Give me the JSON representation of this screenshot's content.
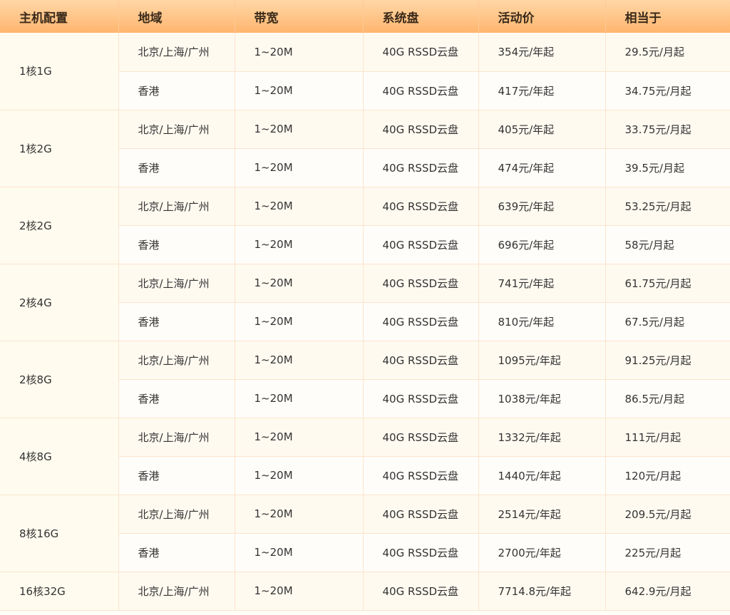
{
  "headers": [
    "主机配置",
    "地域",
    "带宽",
    "系统盘",
    "活动价",
    "相当于"
  ],
  "groups": [
    {
      "config": "1核1G",
      "rows": [
        {
          "region": "北京/上海/广州",
          "bandwidth": "1~20M",
          "disk": "40G RSSD云盘",
          "price": "354元/年起",
          "monthly": "29.5元/月起"
        },
        {
          "region": "香港",
          "bandwidth": "1~20M",
          "disk": "40G RSSD云盘",
          "price": "417元/年起",
          "monthly": "34.75元/月起"
        }
      ]
    },
    {
      "config": "1核2G",
      "rows": [
        {
          "region": "北京/上海/广州",
          "bandwidth": "1~20M",
          "disk": "40G RSSD云盘",
          "price": "405元/年起",
          "monthly": "33.75元/月起"
        },
        {
          "region": "香港",
          "bandwidth": "1~20M",
          "disk": "40G RSSD云盘",
          "price": "474元/年起",
          "monthly": "39.5元/月起"
        }
      ]
    },
    {
      "config": "2核2G",
      "rows": [
        {
          "region": "北京/上海/广州",
          "bandwidth": "1~20M",
          "disk": "40G RSSD云盘",
          "price": "639元/年起",
          "monthly": "53.25元/月起"
        },
        {
          "region": "香港",
          "bandwidth": "1~20M",
          "disk": "40G RSSD云盘",
          "price": "696元/年起",
          "monthly": "58元/月起"
        }
      ]
    },
    {
      "config": "2核4G",
      "rows": [
        {
          "region": "北京/上海/广州",
          "bandwidth": "1~20M",
          "disk": "40G RSSD云盘",
          "price": "741元/年起",
          "monthly": "61.75元/月起"
        },
        {
          "region": "香港",
          "bandwidth": "1~20M",
          "disk": "40G RSSD云盘",
          "price": "810元/年起",
          "monthly": "67.5元/月起"
        }
      ]
    },
    {
      "config": "2核8G",
      "rows": [
        {
          "region": "北京/上海/广州",
          "bandwidth": "1~20M",
          "disk": "40G RSSD云盘",
          "price": "1095元/年起",
          "monthly": "91.25元/月起"
        },
        {
          "region": "香港",
          "bandwidth": "1~20M",
          "disk": "40G RSSD云盘",
          "price": "1038元/年起",
          "monthly": "86.5元/月起"
        }
      ]
    },
    {
      "config": "4核8G",
      "rows": [
        {
          "region": "北京/上海/广州",
          "bandwidth": "1~20M",
          "disk": "40G RSSD云盘",
          "price": "1332元/年起",
          "monthly": "111元/月起"
        },
        {
          "region": "香港",
          "bandwidth": "1~20M",
          "disk": "40G RSSD云盘",
          "price": "1440元/年起",
          "monthly": "120元/月起"
        }
      ]
    },
    {
      "config": "8核16G",
      "rows": [
        {
          "region": "北京/上海/广州",
          "bandwidth": "1~20M",
          "disk": "40G RSSD云盘",
          "price": "2514元/年起",
          "monthly": "209.5元/月起"
        },
        {
          "region": "香港",
          "bandwidth": "1~20M",
          "disk": "40G RSSD云盘",
          "price": "2700元/年起",
          "monthly": "225元/月起"
        }
      ]
    },
    {
      "config": "16核32G",
      "rows": [
        {
          "region": "北京/上海/广州",
          "bandwidth": "1~20M",
          "disk": "40G RSSD云盘",
          "price": "7714.8元/年起",
          "monthly": "642.9元/月起"
        }
      ]
    }
  ]
}
